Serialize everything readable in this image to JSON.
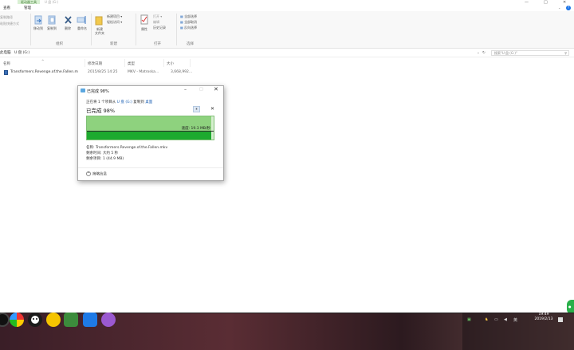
{
  "titlebar": {
    "app_tab": "驱动器工具",
    "path": "U 盘 (G:)",
    "min": "—",
    "max": "□",
    "close": "✕"
  },
  "ribbon_tabs": [
    {
      "label": "查看"
    },
    {
      "label": "管理"
    }
  ],
  "ribbon": {
    "clipboard": {
      "copy_path": "复制路径",
      "paste_shortcut": "粘贴快捷方式"
    },
    "organize": {
      "move_to": "移动到",
      "copy_to": "复制到",
      "delete": "删除",
      "rename": "重命名",
      "label": "组织"
    },
    "new": {
      "new_folder": "新建\n文件夹",
      "new_item": "新建项目",
      "easy_access": "轻松访问",
      "label": "新建"
    },
    "open": {
      "properties": "属性",
      "open": "打开",
      "edit": "编辑",
      "history": "历史记录",
      "label": "打开"
    },
    "select": {
      "select_all": "全部选择",
      "select_none": "全部取消",
      "invert": "反向选择",
      "label": "选择"
    }
  },
  "address": {
    "path_text": "U 盘 (G:)",
    "left_prefix": "此电脑",
    "search_placeholder": "搜索\"U 盘 (G:)\""
  },
  "columns": [
    "名称",
    "修改日期",
    "类型",
    "大小"
  ],
  "files": [
    {
      "name": "Transformers.Revenge.of.the.Fallen.m",
      "modified": "2015/8/25 14:25",
      "type": "MKV - Matroska...",
      "size": "3,668,992..."
    }
  ],
  "dialog": {
    "title": "已完成 98%",
    "source_prefix": "正在将 1 个项目从",
    "source_drive": "U 盘 (G:)",
    "source_mid": "复制到",
    "dest": "桌面",
    "percent_label": "已完成 98%",
    "progress": 0.98,
    "speed": "速度: 19.3 MB/秒",
    "pause": "⏸",
    "stop": "✕",
    "name_line": "名称: Transformers.Revenge.of.the.Fallen.mkv",
    "time_left": "剩余时间: 大约 5 秒",
    "items_left": "剩余项目: 1 (44.9 MB)",
    "fewer_details": "简略信息"
  },
  "taskbar": {
    "time": "19:49",
    "date": "2019/2/13"
  },
  "colors": {
    "accent": "#1a73e8",
    "progress_fill": "#1daa2f",
    "progress_bg": "#d6efcf"
  }
}
